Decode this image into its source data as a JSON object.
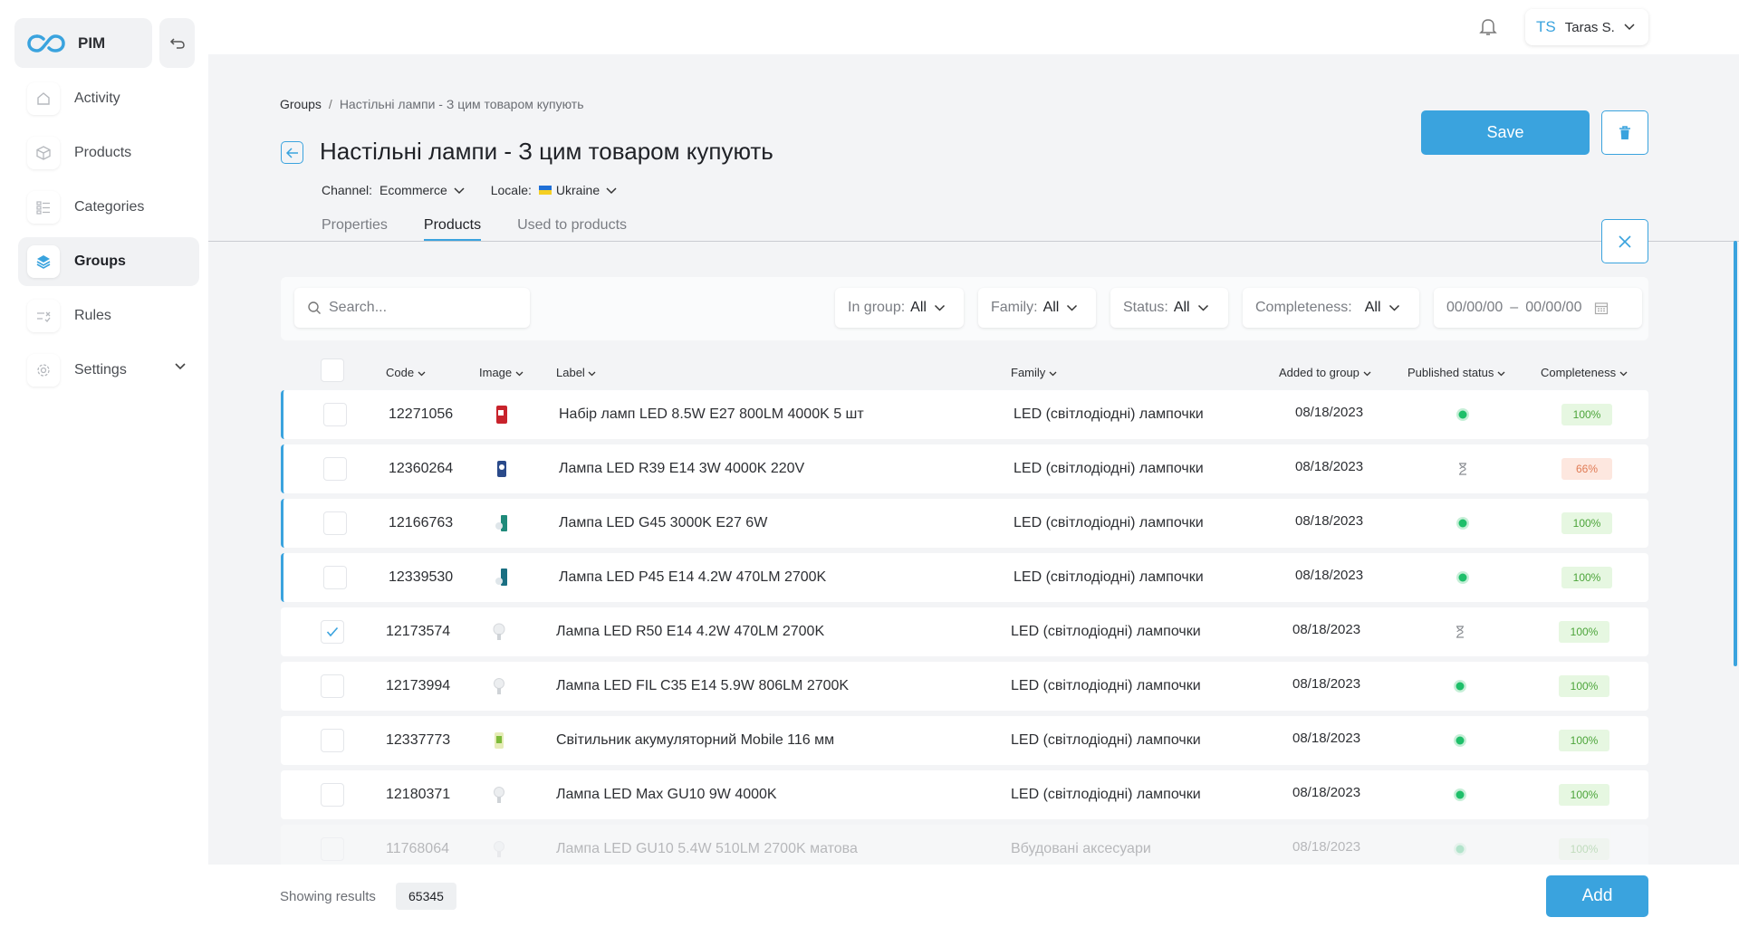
{
  "app": {
    "name": "PIM"
  },
  "sidebar": {
    "items": [
      {
        "label": "Activity",
        "icon": "home-icon"
      },
      {
        "label": "Products",
        "icon": "box-icon"
      },
      {
        "label": "Categories",
        "icon": "list-icon"
      },
      {
        "label": "Groups",
        "icon": "layers-icon",
        "active": true
      },
      {
        "label": "Rules",
        "icon": "rules-icon"
      },
      {
        "label": "Settings",
        "icon": "gear-icon"
      }
    ]
  },
  "user": {
    "initials": "TS",
    "name": "Taras S."
  },
  "breadcrumb": {
    "root": "Groups",
    "separator": "/",
    "current": "Настільні лампи - З цим товаром купують"
  },
  "page": {
    "title": "Настільні лампи - З цим товаром купують",
    "save_label": "Save"
  },
  "selectors": {
    "channel_label": "Channel:",
    "channel_value": "Ecommerce",
    "locale_label": "Locale:",
    "locale_value": "Ukraine"
  },
  "tabs": [
    {
      "label": "Properties"
    },
    {
      "label": "Products",
      "active": true
    },
    {
      "label": "Used to products"
    }
  ],
  "filters": {
    "search_placeholder": "Search...",
    "in_group": {
      "label": "In group:",
      "value": "All"
    },
    "family": {
      "label": "Family:",
      "value": "All"
    },
    "status": {
      "label": "Status:",
      "value": "All"
    },
    "completeness": {
      "label": "Completeness:",
      "value": "All"
    },
    "date_from": "00/00/00",
    "date_sep": "–",
    "date_to": "00/00/00"
  },
  "table": {
    "columns": {
      "code": "Code",
      "image": "Image",
      "label": "Label",
      "family": "Family",
      "added": "Added to group",
      "published": "Published status",
      "completeness": "Completeness"
    },
    "rows": [
      {
        "code": "12271056",
        "label": "Набір ламп LED 8.5W E27 800LM 4000K 5 шт",
        "family": "LED (світлодіодні) лампочки",
        "added": "08/18/2023",
        "status": "published",
        "completeness": "100%",
        "checked": false,
        "marked": true
      },
      {
        "code": "12360264",
        "label": "Лампа LED R39 E14 3W 4000K 220V",
        "family": "LED (світлодіодні) лампочки",
        "added": "08/18/2023",
        "status": "pending",
        "completeness": "66%",
        "checked": false,
        "marked": true
      },
      {
        "code": "12166763",
        "label": "Лампа LED G45 3000K E27 6W",
        "family": "LED (світлодіодні) лампочки",
        "added": "08/18/2023",
        "status": "published",
        "completeness": "100%",
        "checked": false,
        "marked": true
      },
      {
        "code": "12339530",
        "label": "Лампа LED P45 E14 4.2W 470LM 2700K",
        "family": "LED (світлодіодні) лампочки",
        "added": "08/18/2023",
        "status": "published",
        "completeness": "100%",
        "checked": false,
        "marked": true
      },
      {
        "code": "12173574",
        "label": "Лампа LED R50 E14 4.2W 470LM 2700K",
        "family": "LED (світлодіодні) лампочки",
        "added": "08/18/2023",
        "status": "pending",
        "completeness": "100%",
        "checked": true,
        "marked": false
      },
      {
        "code": "12173994",
        "label": "Лампа LED FIL C35 E14 5.9W 806LM 2700K",
        "family": "LED (світлодіодні) лампочки",
        "added": "08/18/2023",
        "status": "published",
        "completeness": "100%",
        "checked": false,
        "marked": false
      },
      {
        "code": "12337773",
        "label": "Світильник акумуляторний Mobile 116 мм",
        "family": "LED (світлодіодні) лампочки",
        "added": "08/18/2023",
        "status": "published",
        "completeness": "100%",
        "checked": false,
        "marked": false
      },
      {
        "code": "12180371",
        "label": "Лампа LED Max GU10 9W 4000K",
        "family": "LED (світлодіодні) лампочки",
        "added": "08/18/2023",
        "status": "published",
        "completeness": "100%",
        "checked": false,
        "marked": false
      },
      {
        "code": "11768064",
        "label": "Лампа LED GU10 5.4W 510LM 2700K матова",
        "family": "Вбудовані аксесуари",
        "added": "08/18/2023",
        "status": "published",
        "completeness": "100%",
        "checked": false,
        "marked": false,
        "faded": true
      }
    ]
  },
  "footer": {
    "showing_label": "Showing results",
    "count": "65345",
    "add_label": "Add"
  },
  "colors": {
    "accent": "#3aa3de",
    "published": "#1fbf6a",
    "pending": "#8a8d92",
    "complete_bg": "#e6f7e1",
    "partial_bg": "#fde7df"
  }
}
